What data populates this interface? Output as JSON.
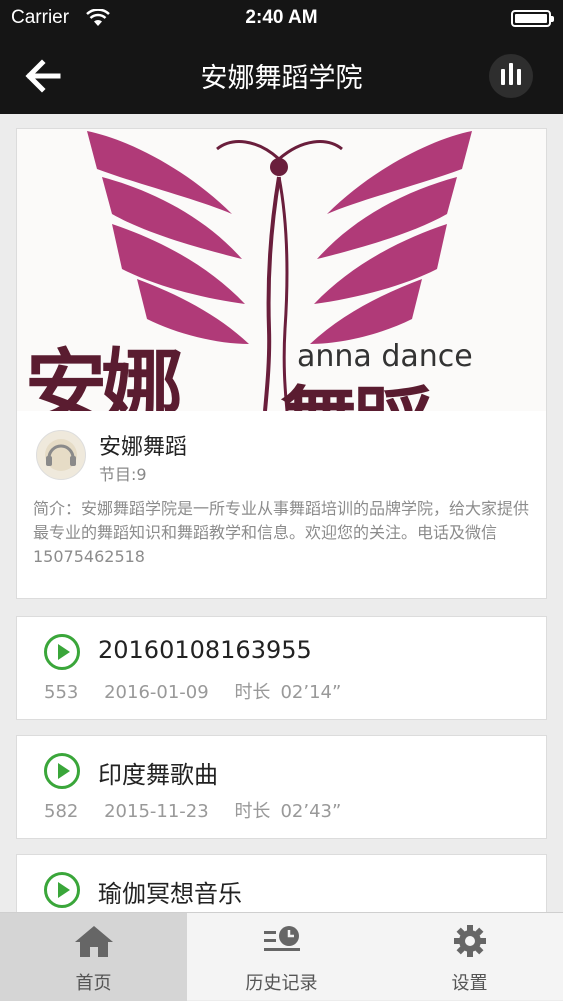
{
  "status_bar": {
    "carrier": "Carrier",
    "time": "2:40 AM"
  },
  "nav": {
    "title": "安娜舞蹈学院",
    "back_icon": "arrow-left-icon",
    "player_icon": "audio-bars-icon"
  },
  "banner": {
    "logo_text_en": "anna dance",
    "logo_text_cn_left": "安娜",
    "logo_text_cn_right": "舞蹈",
    "accent_color": "#b03a78"
  },
  "profile": {
    "name": "安娜舞蹈",
    "count": "节目:9",
    "intro": "简介：安娜舞蹈学院是一所专业从事舞蹈培训的品牌学院，给大家提供最专业的舞蹈知识和舞蹈教学和信息。欢迎您的关注。电话及微信15075462518"
  },
  "tracks": [
    {
      "title": "20160108163955",
      "plays": "553",
      "date": "2016-01-09",
      "duration_label": "时长",
      "duration": "02’14”"
    },
    {
      "title": "印度舞歌曲",
      "plays": "582",
      "date": "2015-11-23",
      "duration_label": "时长",
      "duration": "02’43”"
    },
    {
      "title": "瑜伽冥想音乐"
    }
  ],
  "colors": {
    "play_green": "#3aa63a",
    "bar_dark": "#151515"
  },
  "tabs": [
    {
      "label": "首页",
      "icon": "home-icon",
      "active": true
    },
    {
      "label": "历史记录",
      "icon": "history-icon",
      "active": false
    },
    {
      "label": "设置",
      "icon": "gear-icon",
      "active": false
    }
  ]
}
